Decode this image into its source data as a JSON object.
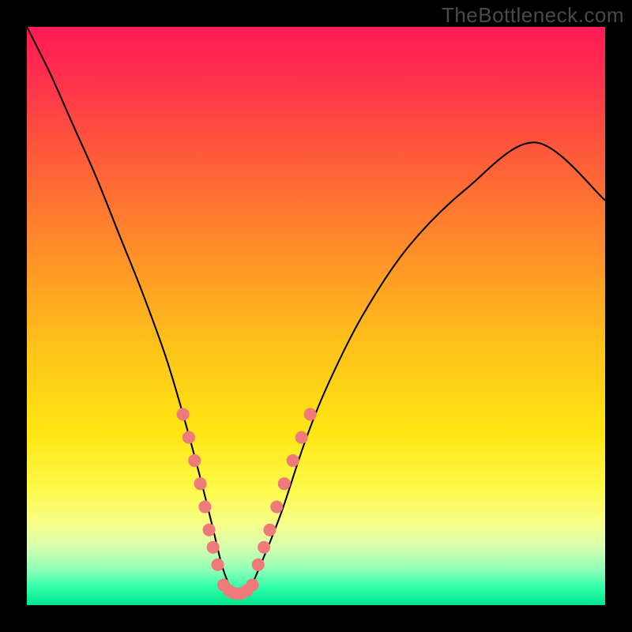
{
  "watermark": "TheBottleneck.com",
  "chart_data": {
    "type": "line",
    "title": "",
    "xlabel": "",
    "ylabel": "",
    "xlim": [
      0,
      100
    ],
    "ylim": [
      0,
      100
    ],
    "background_gradient": {
      "stops": [
        {
          "offset": 0.0,
          "color": "#ff1a55"
        },
        {
          "offset": 0.08,
          "color": "#ff2e4e"
        },
        {
          "offset": 0.22,
          "color": "#ff5a3a"
        },
        {
          "offset": 0.38,
          "color": "#ff8c2a"
        },
        {
          "offset": 0.55,
          "color": "#ffc21a"
        },
        {
          "offset": 0.7,
          "color": "#ffe612"
        },
        {
          "offset": 0.8,
          "color": "#fff94a"
        },
        {
          "offset": 0.86,
          "color": "#f7ff8a"
        },
        {
          "offset": 0.9,
          "color": "#d6ffb0"
        },
        {
          "offset": 0.94,
          "color": "#8cffb8"
        },
        {
          "offset": 0.97,
          "color": "#2effa8"
        },
        {
          "offset": 1.0,
          "color": "#00e58c"
        }
      ]
    },
    "series": [
      {
        "name": "bottleneck-curve",
        "color": "#000000",
        "x": [
          0,
          4,
          8,
          12,
          16,
          20,
          24,
          27,
          30,
          32,
          34,
          36,
          38,
          40,
          44,
          48,
          52,
          58,
          66,
          76,
          88,
          100
        ],
        "y": [
          100,
          92,
          83,
          74,
          64,
          54,
          43,
          33,
          22,
          14,
          6,
          2,
          2,
          6,
          16,
          28,
          38,
          50,
          62,
          72,
          80,
          70
        ]
      }
    ],
    "markers_left": {
      "color": "#ef7a7a",
      "points": [
        {
          "x": 27.0,
          "y": 33
        },
        {
          "x": 28.0,
          "y": 29
        },
        {
          "x": 29.0,
          "y": 25
        },
        {
          "x": 30.0,
          "y": 21
        },
        {
          "x": 30.8,
          "y": 17
        },
        {
          "x": 31.5,
          "y": 13
        },
        {
          "x": 32.2,
          "y": 10
        },
        {
          "x": 33.0,
          "y": 7
        }
      ]
    },
    "markers_right": {
      "color": "#ef7a7a",
      "points": [
        {
          "x": 40.0,
          "y": 7
        },
        {
          "x": 41.0,
          "y": 10
        },
        {
          "x": 42.0,
          "y": 13
        },
        {
          "x": 43.2,
          "y": 17
        },
        {
          "x": 44.5,
          "y": 21
        },
        {
          "x": 46.0,
          "y": 25
        },
        {
          "x": 47.5,
          "y": 29
        },
        {
          "x": 49.0,
          "y": 33
        }
      ]
    },
    "markers_bottom": {
      "color": "#ef7a7a",
      "points": [
        {
          "x": 34.0,
          "y": 3.5
        },
        {
          "x": 35.0,
          "y": 2.5
        },
        {
          "x": 36.0,
          "y": 2.0
        },
        {
          "x": 37.0,
          "y": 2.0
        },
        {
          "x": 38.0,
          "y": 2.5
        },
        {
          "x": 39.0,
          "y": 3.5
        }
      ]
    }
  }
}
